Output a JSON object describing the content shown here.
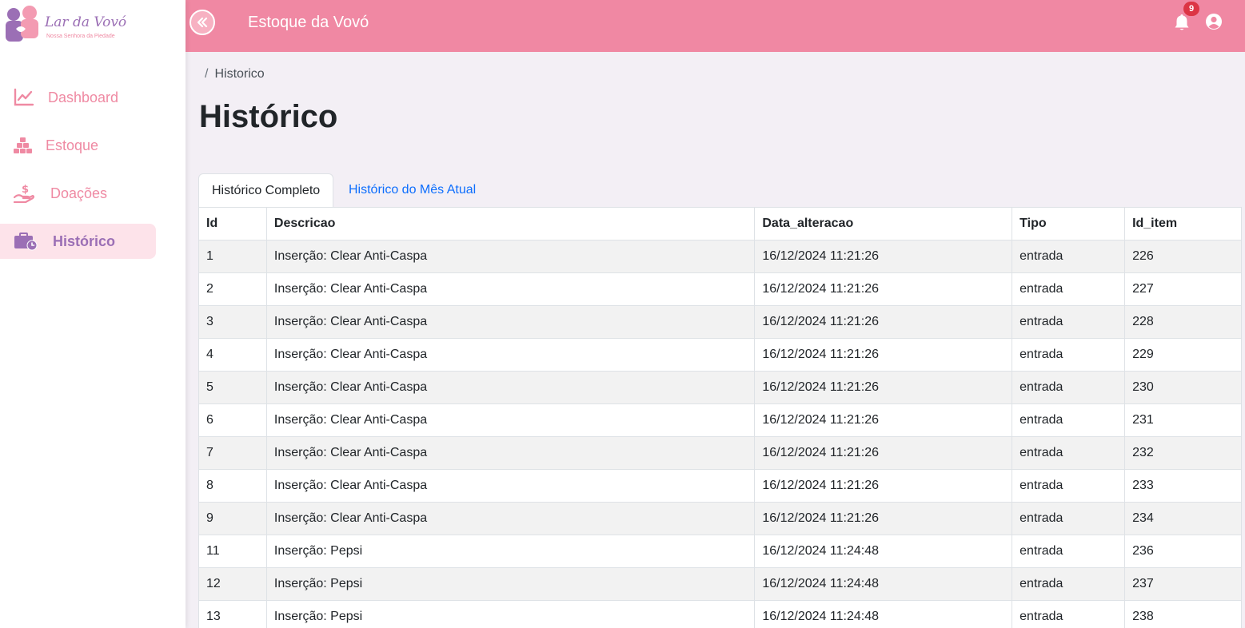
{
  "brand": {
    "title": "Lar da Vovó",
    "subtitle": "Nossa Senhora da Piedade"
  },
  "sidebar": {
    "items": [
      {
        "label": "Dashboard",
        "icon": "chart-line-icon",
        "active": false
      },
      {
        "label": "Estoque",
        "icon": "boxes-icon",
        "active": false
      },
      {
        "label": "Doações",
        "icon": "hand-holding-dollar-icon",
        "active": false
      },
      {
        "label": "Histórico",
        "icon": "briefcase-clock-icon",
        "active": true
      }
    ]
  },
  "header": {
    "title": "Estoque da Vovó",
    "notifications_count": "9"
  },
  "breadcrumb": {
    "separator": "/",
    "current": "Historico"
  },
  "page": {
    "title": "Histórico"
  },
  "tabs": [
    {
      "label": "Histórico Completo",
      "active": true
    },
    {
      "label": "Histórico do Mês Atual",
      "active": false
    }
  ],
  "table": {
    "columns": [
      "Id",
      "Descricao",
      "Data_alteracao",
      "Tipo",
      "Id_item"
    ],
    "rows": [
      [
        "1",
        "Inserção: Clear Anti-Caspa",
        "16/12/2024 11:21:26",
        "entrada",
        "226"
      ],
      [
        "2",
        "Inserção: Clear Anti-Caspa",
        "16/12/2024 11:21:26",
        "entrada",
        "227"
      ],
      [
        "3",
        "Inserção: Clear Anti-Caspa",
        "16/12/2024 11:21:26",
        "entrada",
        "228"
      ],
      [
        "4",
        "Inserção: Clear Anti-Caspa",
        "16/12/2024 11:21:26",
        "entrada",
        "229"
      ],
      [
        "5",
        "Inserção: Clear Anti-Caspa",
        "16/12/2024 11:21:26",
        "entrada",
        "230"
      ],
      [
        "6",
        "Inserção: Clear Anti-Caspa",
        "16/12/2024 11:21:26",
        "entrada",
        "231"
      ],
      [
        "7",
        "Inserção: Clear Anti-Caspa",
        "16/12/2024 11:21:26",
        "entrada",
        "232"
      ],
      [
        "8",
        "Inserção: Clear Anti-Caspa",
        "16/12/2024 11:21:26",
        "entrada",
        "233"
      ],
      [
        "9",
        "Inserção: Clear Anti-Caspa",
        "16/12/2024 11:21:26",
        "entrada",
        "234"
      ],
      [
        "11",
        "Inserção: Pepsi",
        "16/12/2024 11:24:48",
        "entrada",
        "236"
      ],
      [
        "12",
        "Inserção: Pepsi",
        "16/12/2024 11:24:48",
        "entrada",
        "237"
      ],
      [
        "13",
        "Inserção: Pepsi",
        "16/12/2024 11:24:48",
        "entrada",
        "238"
      ]
    ]
  },
  "colors": {
    "header_bg": "#f088a3",
    "sidebar_text": "#ef8aa3",
    "active_text": "#9b6fb5",
    "active_bg": "#fde3ea",
    "page_bg": "#f3eff5",
    "link": "#0d6efd",
    "badge": "#dc3545"
  }
}
